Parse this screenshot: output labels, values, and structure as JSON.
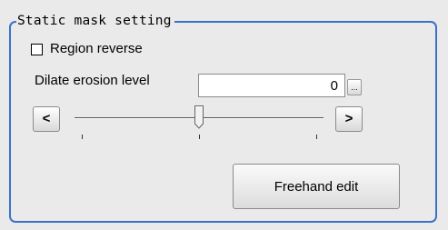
{
  "group": {
    "title": "Static mask setting"
  },
  "region_reverse": {
    "label": "Region reverse",
    "checked": false
  },
  "dilate_erosion": {
    "label": "Dilate erosion level",
    "value": "0",
    "ellipsis_label": "...",
    "decrement_label": "<",
    "increment_label": ">",
    "slider": {
      "min": -1,
      "max": 1,
      "value": 0
    }
  },
  "freehand_edit": {
    "label": "Freehand edit"
  }
}
